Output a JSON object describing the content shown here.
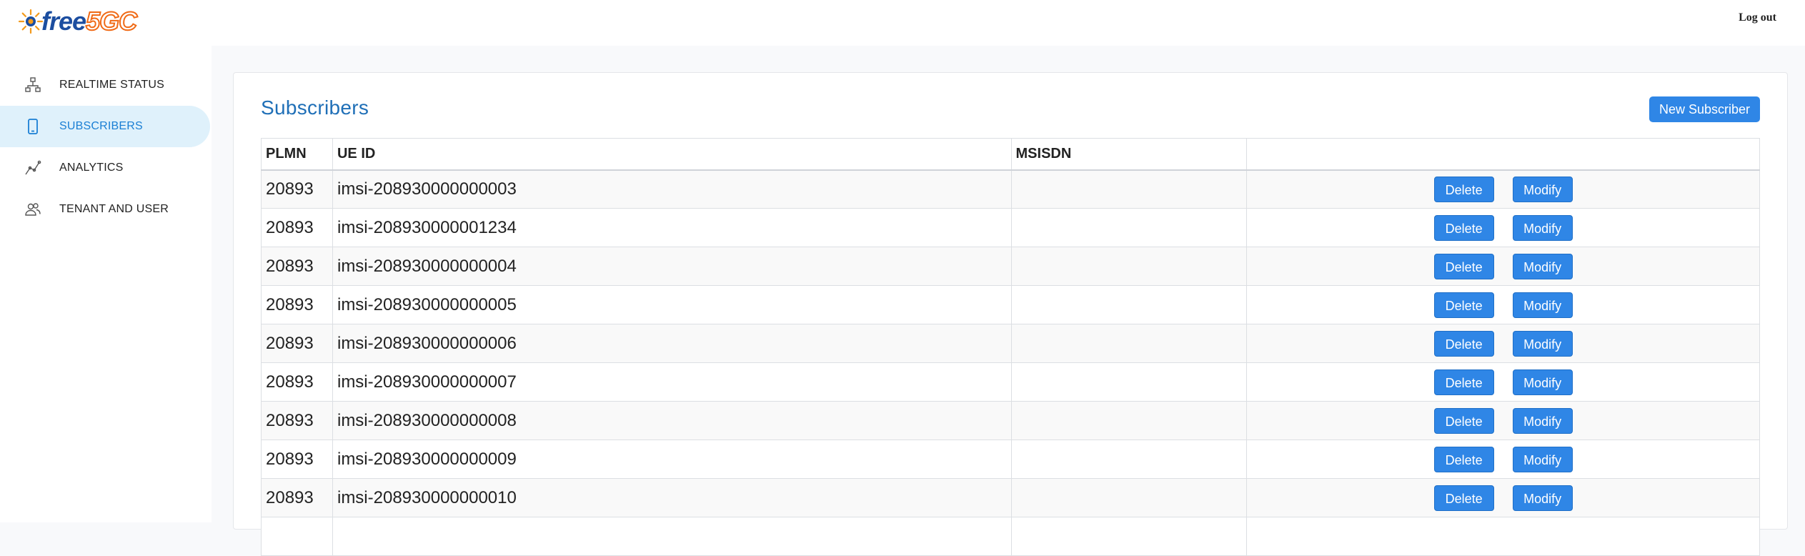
{
  "app": {
    "logo_text_a": "free",
    "logo_text_b": "5GC"
  },
  "header": {
    "logout_label": "Log out"
  },
  "sidebar": {
    "items": [
      {
        "label": "REALTIME STATUS",
        "icon": "network-icon",
        "active": false
      },
      {
        "label": "SUBSCRIBERS",
        "icon": "phone-icon",
        "active": true
      },
      {
        "label": "ANALYTICS",
        "icon": "chart-line-icon",
        "active": false
      },
      {
        "label": "TENANT AND USER",
        "icon": "users-icon",
        "active": false
      }
    ]
  },
  "main": {
    "title": "Subscribers",
    "new_button_label": "New Subscriber",
    "columns": [
      "PLMN",
      "UE ID",
      "MSISDN",
      ""
    ],
    "rows": [
      {
        "plmn": "20893",
        "ue_id": "imsi-208930000000003",
        "msisdn": ""
      },
      {
        "plmn": "20893",
        "ue_id": "imsi-208930000001234",
        "msisdn": ""
      },
      {
        "plmn": "20893",
        "ue_id": "imsi-208930000000004",
        "msisdn": ""
      },
      {
        "plmn": "20893",
        "ue_id": "imsi-208930000000005",
        "msisdn": ""
      },
      {
        "plmn": "20893",
        "ue_id": "imsi-208930000000006",
        "msisdn": ""
      },
      {
        "plmn": "20893",
        "ue_id": "imsi-208930000000007",
        "msisdn": ""
      },
      {
        "plmn": "20893",
        "ue_id": "imsi-208930000000008",
        "msisdn": ""
      },
      {
        "plmn": "20893",
        "ue_id": "imsi-208930000000009",
        "msisdn": ""
      },
      {
        "plmn": "20893",
        "ue_id": "imsi-208930000000010",
        "msisdn": ""
      },
      {
        "plmn": "",
        "ue_id": "",
        "msisdn": ""
      }
    ],
    "delete_label": "Delete",
    "modify_label": "Modify"
  },
  "colors": {
    "accent": "#2f86e6",
    "title": "#1f6fb7",
    "active_nav_bg": "#dff1fb",
    "logo_blue": "#1c4ea0",
    "logo_orange": "#f06a16"
  }
}
